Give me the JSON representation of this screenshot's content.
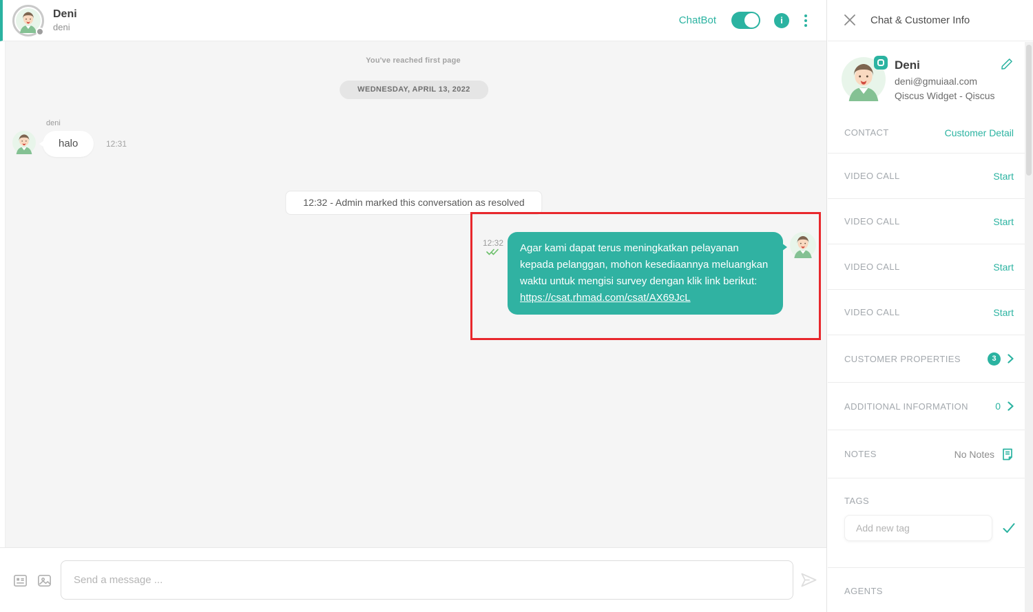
{
  "colors": {
    "accent": "#2bb3a1",
    "bubble": "#30b2a2",
    "highlight_red": "#e8272c",
    "check_green": "#6abf69"
  },
  "header": {
    "customer_name": "Deni",
    "customer_username": "deni",
    "chatbot_label": "ChatBot",
    "chatbot_toggle_state": "on"
  },
  "chat": {
    "first_page_notice": "You've reached first page",
    "date_separator": "WEDNESDAY, APRIL 13, 2022",
    "incoming": {
      "sender": "deni",
      "text": "halo",
      "time": "12:31"
    },
    "system_message": "12:32 - Admin marked this conversation as resolved",
    "outgoing": {
      "time": "12:32",
      "text": "Agar kami dapat terus meningkatkan pelayanan kepada pelanggan, mohon kesediaannya meluangkan waktu untuk mengisi survey dengan klik link berikut:",
      "link": "https://csat.rhmad.com/csat/AX69JcL",
      "status": "delivered"
    }
  },
  "composer": {
    "placeholder": "Send a message ..."
  },
  "sidebar": {
    "title": "Chat & Customer Info",
    "customer": {
      "name": "Deni",
      "email": "deni@gmuiaal.com",
      "channel": "Qiscus Widget - Qiscus"
    },
    "contact": {
      "label": "CONTACT",
      "action": "Customer Detail"
    },
    "video_calls": [
      {
        "label": "VIDEO CALL",
        "action": "Start"
      },
      {
        "label": "VIDEO CALL",
        "action": "Start"
      },
      {
        "label": "VIDEO CALL",
        "action": "Start"
      },
      {
        "label": "VIDEO CALL",
        "action": "Start"
      }
    ],
    "customer_properties": {
      "label": "CUSTOMER PROPERTIES",
      "count": "3"
    },
    "additional_information": {
      "label": "ADDITIONAL INFORMATION",
      "count": "0"
    },
    "notes": {
      "label": "NOTES",
      "value": "No Notes"
    },
    "tags": {
      "label": "TAGS",
      "placeholder": "Add new tag"
    },
    "agents": {
      "label": "AGENTS"
    }
  },
  "icons": {
    "close": "✕",
    "info": "i",
    "kebab_menu": "⋮",
    "edit_pencil": "✎",
    "chevron_right": "❯",
    "double_check": "✓✓",
    "checkmark": "✓",
    "note_document": "🗎",
    "send_plane": "▷",
    "template_message": "🗋",
    "attach_image": "🖻"
  }
}
